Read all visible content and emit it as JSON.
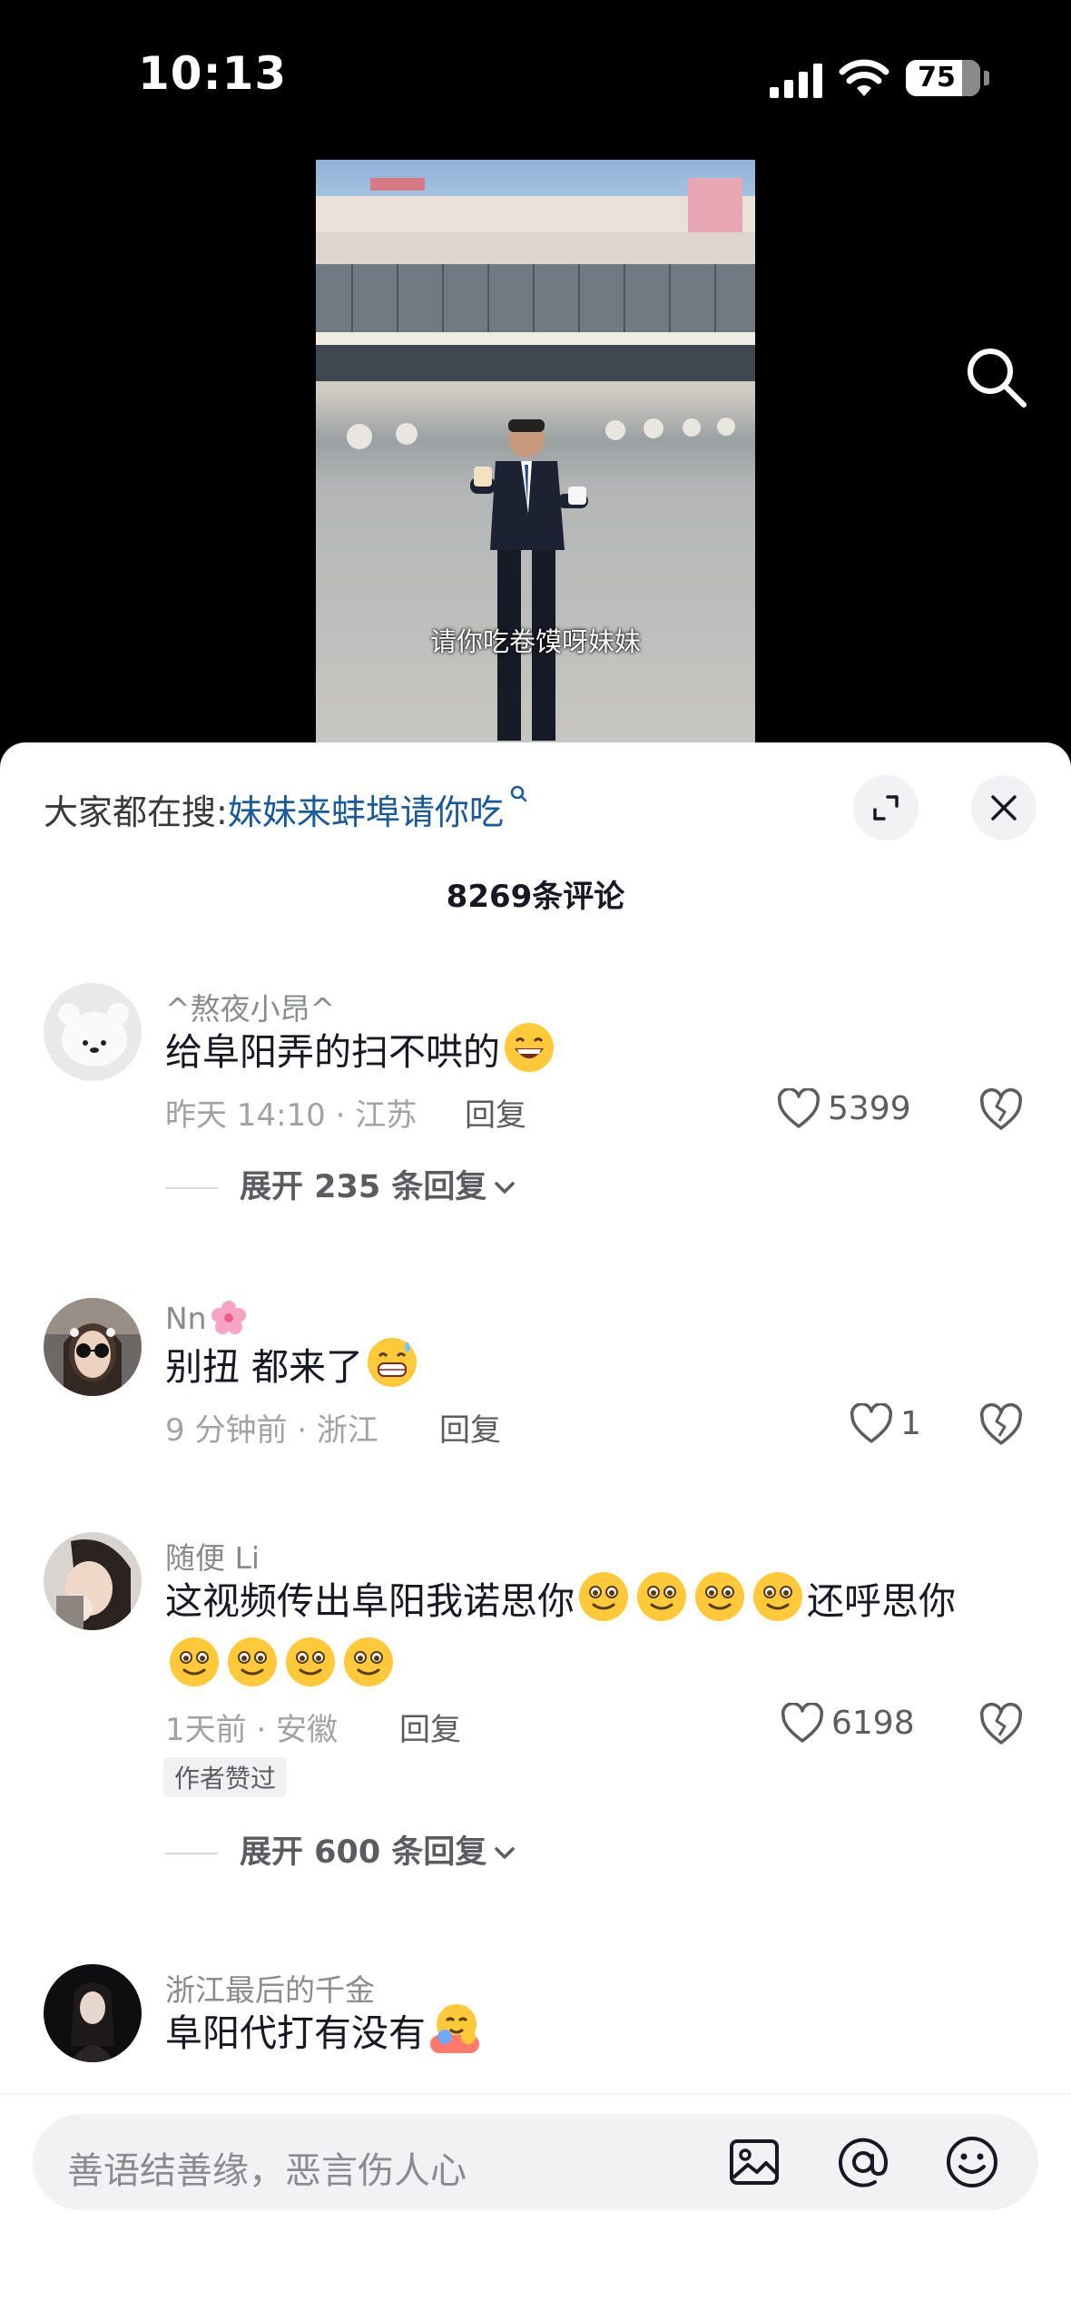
{
  "status_bar": {
    "time": "10:13",
    "battery_level": "75",
    "battery_fraction": 0.75,
    "icons": [
      "signal-icon",
      "wifi-icon",
      "battery-icon"
    ]
  },
  "video": {
    "subtitle": "请你吃卷馍呀妹妹"
  },
  "header": {
    "hot_search_prefix": "大家都在搜:",
    "hot_search_query": "妹妹来蚌埠请你吃",
    "comment_count": "8269条评论",
    "icons": [
      "search-icon",
      "expand-icon",
      "close-icon"
    ]
  },
  "comments": [
    {
      "username": "^熬夜小昂^",
      "text": "给阜阳弄的扫不哄的",
      "emojis": [
        "grin-emoji"
      ],
      "time_location": "昨天 14:10 · 江苏",
      "reply_label": "回复",
      "likes": "5399",
      "expand_label": "展开 235 条回复"
    },
    {
      "username": "Nn",
      "username_emoji": "cherry-blossom-emoji",
      "text": "别扭 都来了",
      "emojis": [
        "grin-sweat-emoji"
      ],
      "time_location": "9 分钟前 · 浙江",
      "reply_label": "回复",
      "likes": "1"
    },
    {
      "username": "随便 Li",
      "text_part1": "这视频传出阜阳我诺思你",
      "text_part2": "还呼思你",
      "emojis": [
        "flushed-smile-emoji"
      ],
      "time_location": "1天前 · 安徽",
      "reply_label": "回复",
      "likes": "6198",
      "badge": "作者赞过",
      "expand_label": "展开 600 条回复"
    },
    {
      "username": "浙江最后的千金",
      "text": "阜阳代打有没有",
      "emojis": [
        "hug-emoji"
      ]
    }
  ],
  "input_bar": {
    "placeholder": "善语结善缘，恶言伤人心",
    "icons": [
      "image-icon",
      "mention-icon",
      "emoji-icon"
    ]
  },
  "colors": {
    "accent_link": "#1a5a9a",
    "text_primary": "#161823",
    "text_secondary": "#8a8b91",
    "sheet_bg": "#ffffff",
    "pill_bg": "#f2f2f4"
  }
}
